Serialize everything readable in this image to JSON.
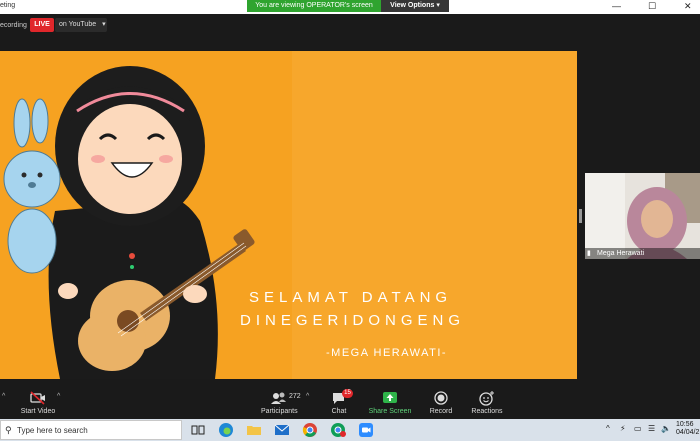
{
  "window": {
    "title": "eting",
    "viewing_banner": "You are viewing OPERATOR's screen",
    "view_options": "View Options",
    "minimize": "—",
    "maximize": "☐",
    "close": "✕"
  },
  "recording": {
    "label": "ecording",
    "live": "LIVE",
    "youtube": "on YouTube"
  },
  "share_content": {
    "line1": "SELAMAT DATANG",
    "line2": "DINEGERIDONGENG",
    "author": "-MEGA HERAWATI-"
  },
  "self_view": {
    "name": "Mega Herawati"
  },
  "toolbar": {
    "start_video": "Start Video",
    "participants": "Participants",
    "participants_count": "272",
    "chat": "Chat",
    "chat_badge": "15",
    "share_screen": "Share Screen",
    "record": "Record",
    "reactions": "Reactions"
  },
  "taskbar": {
    "search_placeholder": "Type here to search",
    "time": "10:56",
    "date": "04/04/2"
  },
  "colors": {
    "slide_background": "#f6a221",
    "live_red": "#e0272b",
    "banner_green": "#2fa42f",
    "share_green": "#2fb44a"
  }
}
